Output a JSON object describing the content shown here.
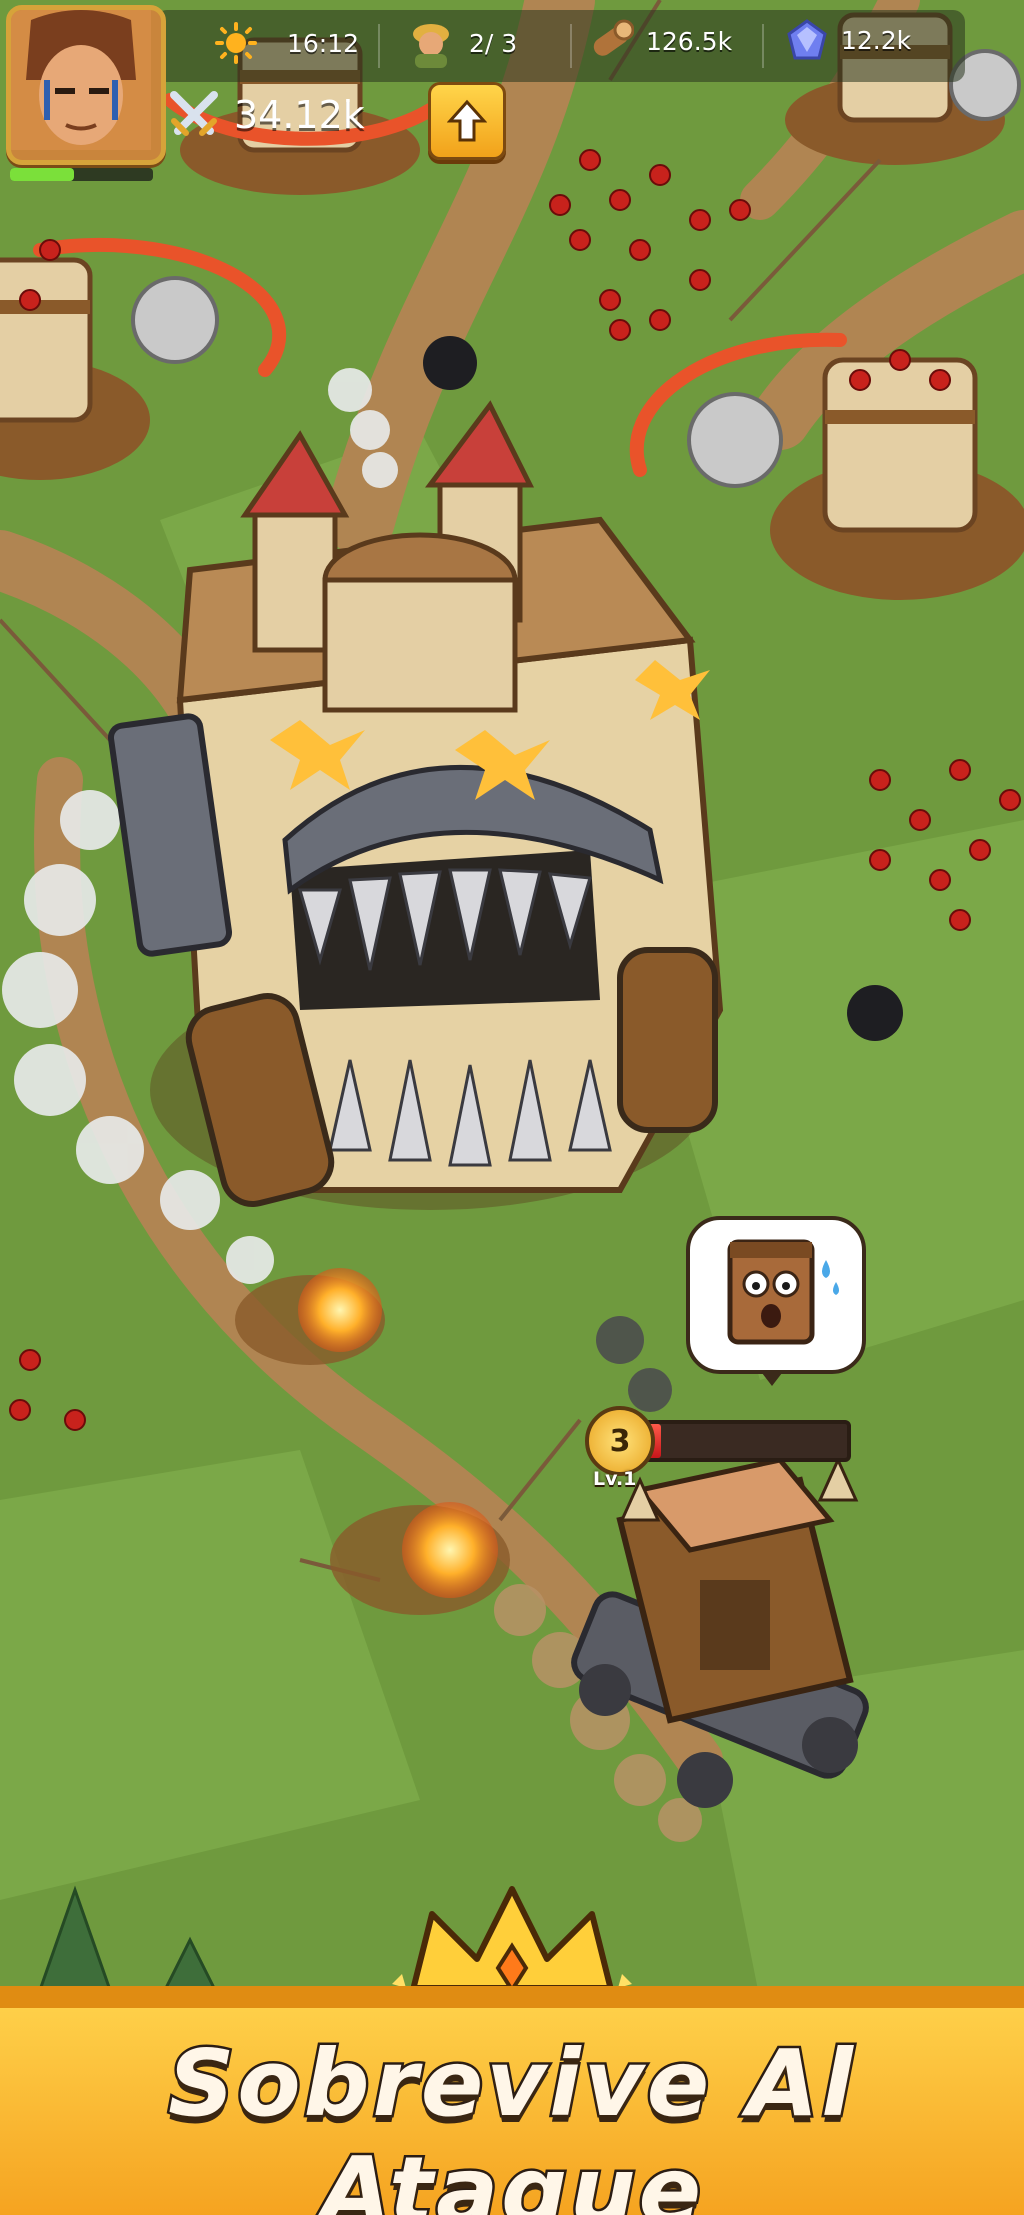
{
  "hud": {
    "time": "16:12",
    "workers": "2/ 3",
    "wood": "126.5k",
    "gems": "12.2k",
    "power": "34.12k",
    "xp_progress": 0.45,
    "icons": [
      "hero-portrait",
      "sun-icon",
      "worker-icon",
      "wood-log-icon",
      "gem-icon",
      "crossed-swords-icon",
      "upgrade-arrow-icon"
    ]
  },
  "unit": {
    "level_number": "3",
    "level_label": "Lv.1",
    "health_fraction": 0.07,
    "bubble_icon": "scared-crate-emoji"
  },
  "banner": {
    "title": "Sobrevive Al Ataque",
    "icon": "crown-icon"
  },
  "colors": {
    "grass": "#6f9a3e",
    "banner_yellow": "#ffc93a",
    "hp_red": "#e0221c",
    "xp_green": "#7be03a",
    "enemy_red": "#c8221c"
  }
}
